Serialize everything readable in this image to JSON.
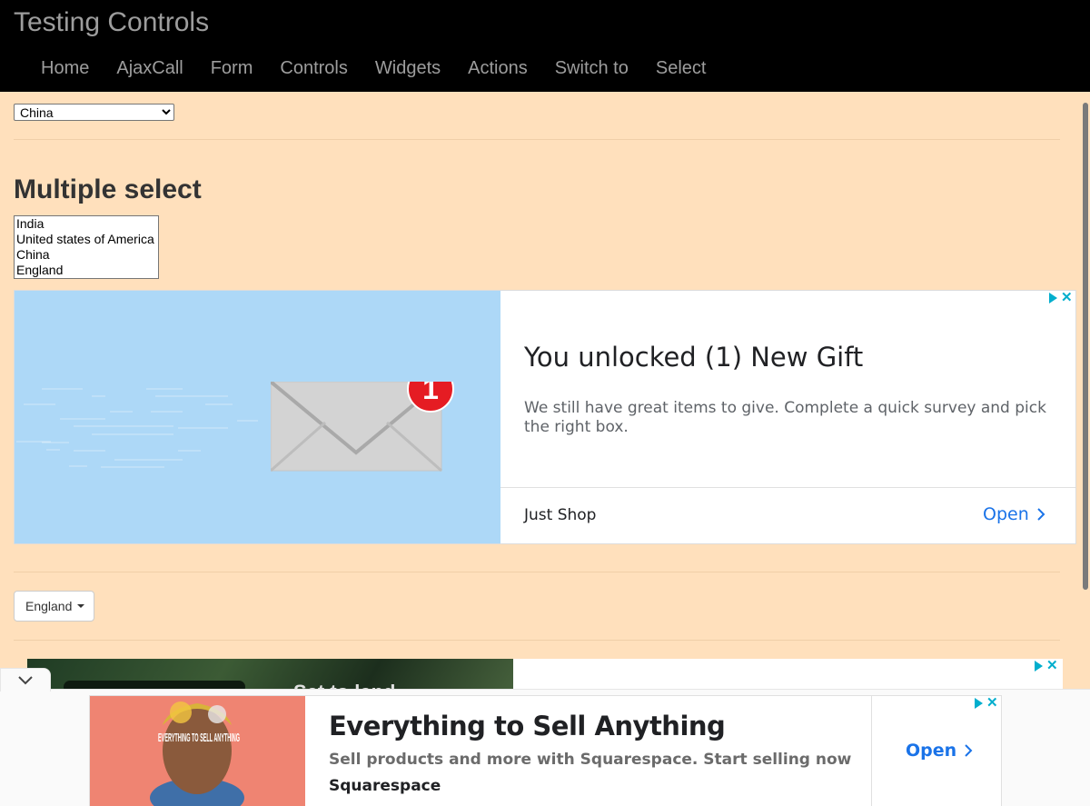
{
  "header": {
    "brand": "Testing Controls",
    "nav": [
      "Home",
      "AjaxCall",
      "Form",
      "Controls",
      "Widgets",
      "Actions",
      "Switch to",
      "Select"
    ]
  },
  "single_select": {
    "selected": "China"
  },
  "multiple_select": {
    "heading": "Multiple select",
    "options": [
      "India",
      "United states of America",
      "China",
      "England"
    ]
  },
  "ad1": {
    "title": "You unlocked (1) New Gift",
    "description": "We still have great items to give. Complete a quick survey and pick the right box.",
    "brand": "Just Shop",
    "open_label": "Open",
    "badge": "1"
  },
  "dropdown": {
    "selected": "England"
  },
  "ad2": {
    "partial_text": "Set to land"
  },
  "anchor_ad": {
    "image_text": "EVERYTHING TO SELL ANYTHING",
    "title": "Everything to Sell Anything",
    "description": "Sell products and more with Squarespace. Start selling now",
    "brand": "Squarespace",
    "open_label": "Open"
  },
  "colors": {
    "page_background": "#ffe0bc",
    "header_background": "#000000",
    "link_blue": "#1a73e8",
    "adchoices": "#00aecd"
  },
  "icons": [
    "adchoices-icon",
    "ad-close-icon",
    "chevron-right-icon",
    "caret-down-icon",
    "collapse-chevron-icon",
    "envelope-icon"
  ]
}
